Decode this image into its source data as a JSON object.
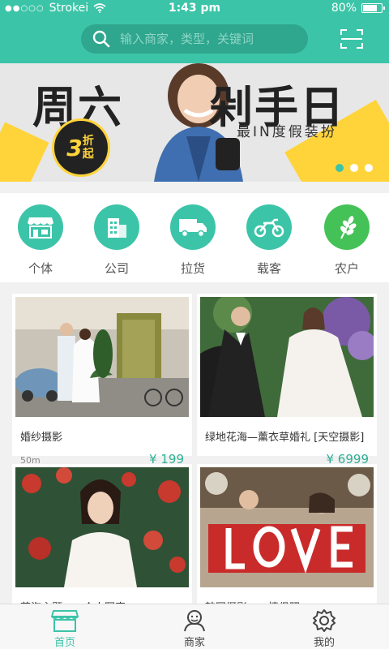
{
  "status": {
    "carrier": "Strokei",
    "time": "1:43 pm",
    "battery": "80%",
    "battery_level": 0.8
  },
  "header": {
    "search_placeholder": "输入商家，类型，关键词",
    "search_icon": "search-icon",
    "scan_icon": "scan-icon"
  },
  "banner": {
    "headline_left": "周六",
    "headline_right": "剁手日",
    "subtitle": "最IN度假装扮",
    "badge_number": "3",
    "badge_text": "折起",
    "slides": 3,
    "active_slide": 0
  },
  "categories": [
    {
      "label": "个体",
      "icon": "shop-icon"
    },
    {
      "label": "公司",
      "icon": "building-icon"
    },
    {
      "label": "拉货",
      "icon": "truck-icon"
    },
    {
      "label": "载客",
      "icon": "motorcycle-icon"
    },
    {
      "label": "农户",
      "icon": "wheat-icon"
    }
  ],
  "listings": [
    {
      "title": "婚纱摄影",
      "distance": "50m",
      "price": "¥ 199"
    },
    {
      "title": "绿地花海—薰衣草婚礼 [天空摄影]",
      "distance": "",
      "price": "¥ 6999"
    },
    {
      "title": "花海主题——个人写真",
      "distance": "",
      "price": ""
    },
    {
      "title": "韩国摄影——情侣照",
      "distance": "",
      "price": ""
    }
  ],
  "tabbar": [
    {
      "label": "首页",
      "icon": "home-icon",
      "active": true
    },
    {
      "label": "商家",
      "icon": "merchant-icon",
      "active": false
    },
    {
      "label": "我的",
      "icon": "settings-icon",
      "active": false
    }
  ],
  "colors": {
    "accent": "#3cc4a8",
    "accent_dark": "#2fa68e",
    "banner_yellow": "#ffd43b",
    "price": "#2fb096"
  }
}
